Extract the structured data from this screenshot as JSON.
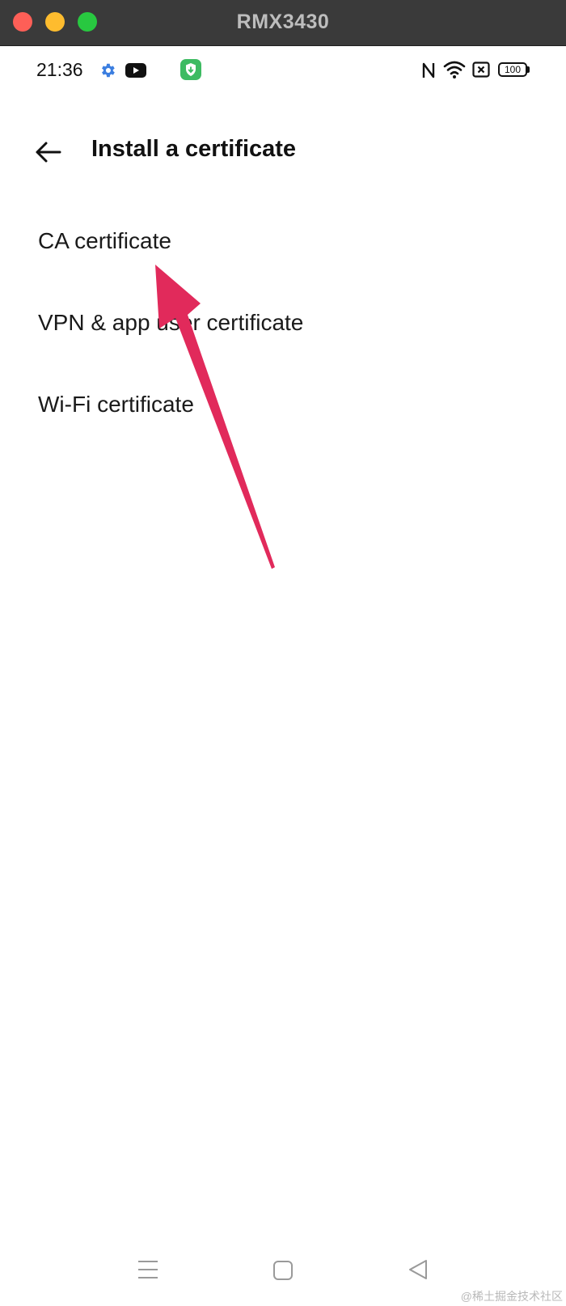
{
  "window": {
    "title": "RMX3430"
  },
  "status_bar": {
    "time": "21:36",
    "battery": "100",
    "icons": [
      "settings-gear-icon",
      "youtube-icon",
      "security-shield-app-icon",
      "nfc-icon",
      "wifi-icon",
      "sim-disabled-icon",
      "battery-icon"
    ]
  },
  "app_bar": {
    "back_icon": "back-arrow-icon",
    "title": "Install a certificate"
  },
  "list": {
    "items": [
      {
        "label": "CA certificate"
      },
      {
        "label": "VPN & app user certificate"
      },
      {
        "label": "Wi-Fi certificate"
      }
    ]
  },
  "annotation": {
    "type": "arrow",
    "color": "#e12a5b",
    "points_to": "CA certificate"
  },
  "nav_bar": {
    "icons": [
      "menu-recents-icon",
      "home-square-icon",
      "back-triangle-icon"
    ]
  },
  "watermark": "@稀土掘金技术社区",
  "colors": {
    "titlebar": "#3a3a3a",
    "close": "#fe5f57",
    "minimize": "#febc2e",
    "maximize": "#28c840",
    "shield_app": "#3dbb62",
    "settings_blue": "#3b7ee0"
  }
}
